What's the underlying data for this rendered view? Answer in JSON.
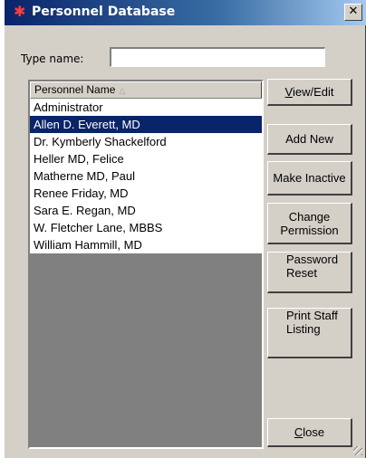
{
  "window": {
    "title": "Personnel Database",
    "close_glyph": "✕"
  },
  "search": {
    "label": "Type name:",
    "value": "",
    "placeholder": ""
  },
  "list": {
    "column_header": "Personnel Name",
    "sort_indicator": "△",
    "rows": [
      "Administrator",
      "Allen D. Everett, MD",
      "Dr. Kymberly Shackelford",
      "Heller MD, Felice",
      "Matherne MD, Paul",
      "Renee Friday, MD",
      "Sara E. Regan, MD",
      "W. Fletcher Lane, MBBS",
      "William Hammill, MD"
    ],
    "selected_row": "Allen D. Everett, MD"
  },
  "buttons": {
    "view_edit": {
      "underline": "V",
      "rest": "iew/Edit"
    },
    "add_new": "Add New",
    "make_inactive": "Make Inactive",
    "change_permission_1": "Change",
    "change_permission_2": "Permission",
    "password_reset_1": "Password",
    "password_reset_2": "Reset",
    "print_staff_1": "Print Staff",
    "print_staff_2": "Listing",
    "close": {
      "underline": "C",
      "rest": "lose"
    }
  },
  "colors": {
    "title_bar_start": "#0a246a",
    "title_bar_end": "#a6caf0",
    "selection": "#0a246a",
    "dialog_face": "#d4d0c8",
    "list_empty_area": "#808080"
  }
}
